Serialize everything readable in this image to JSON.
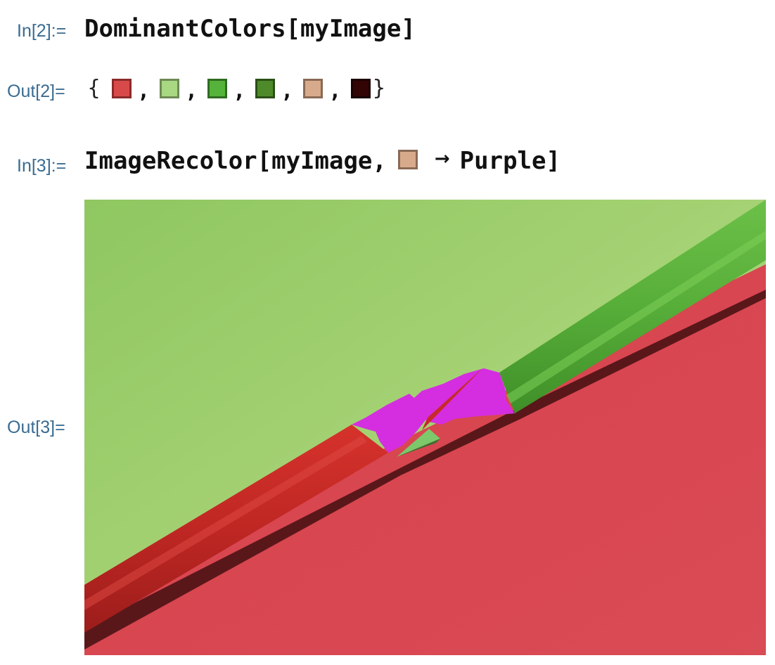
{
  "cells": [
    {
      "in_label": "In[2]:=",
      "code": "DominantColors[myImage]",
      "out_label": "Out[2]=",
      "output": {
        "open_brace": "{",
        "close_brace": "}",
        "separator": ",",
        "swatches": [
          {
            "name": "red",
            "fill": "#d84a4a",
            "border": "#8a2a2a"
          },
          {
            "name": "light-green",
            "fill": "#a8d882",
            "border": "#6e8a55"
          },
          {
            "name": "green",
            "fill": "#55b23a",
            "border": "#2f6b22"
          },
          {
            "name": "dark-green",
            "fill": "#4e8a2a",
            "border": "#2a4f16"
          },
          {
            "name": "tan",
            "fill": "#d8aa8c",
            "border": "#8a6a55"
          },
          {
            "name": "dark-brown",
            "fill": "#330404",
            "border": "#1a0202"
          }
        ]
      }
    },
    {
      "in_label": "In[3]:=",
      "code_prefix": "ImageRecolor[myImage,",
      "inline_swatch": {
        "name": "tan",
        "fill": "#d8aa8c",
        "border": "#8a6a55"
      },
      "arrow": "→",
      "code_suffix": "Purple]",
      "out_label": "Out[3]=",
      "image": {
        "description_colors": {
          "background_top": "#a3d16f",
          "background_bottom": "#d7454f",
          "green_pencil": "#58b03a",
          "red_pencil": "#c52a26",
          "recolored_wood": "#d42ee0"
        }
      }
    }
  ]
}
